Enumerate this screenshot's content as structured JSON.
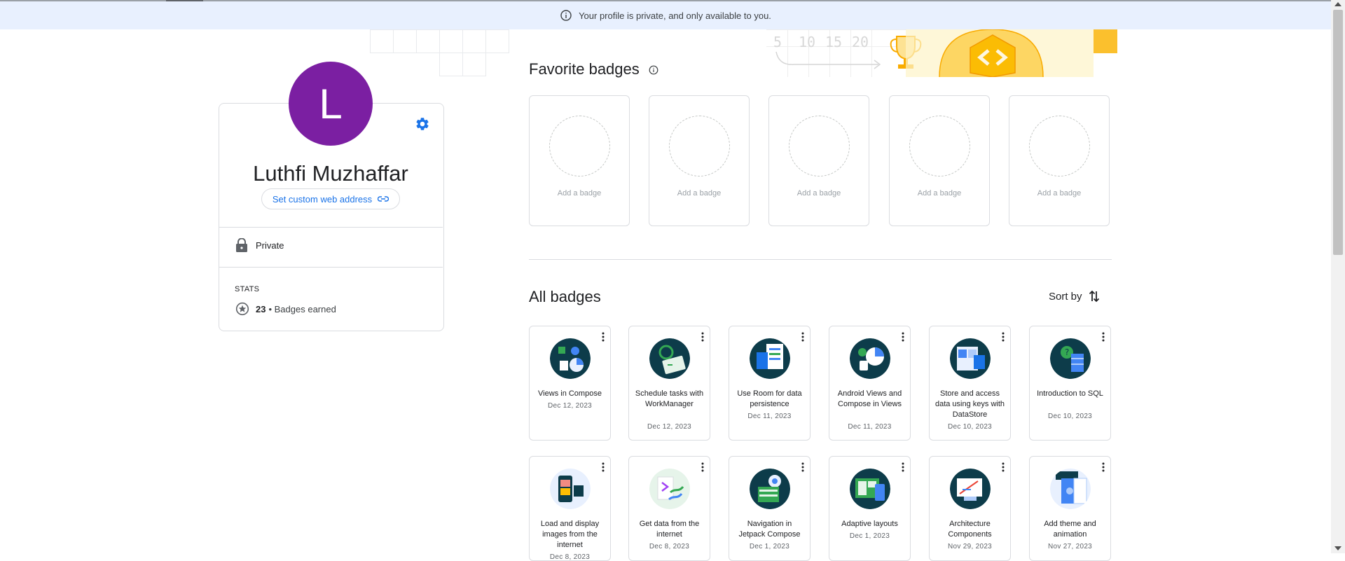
{
  "banner": {
    "text": "Your profile is private, and only available to you.",
    "icon": "info-icon"
  },
  "profile": {
    "avatar_letter": "L",
    "avatar_color": "#7b1fa2",
    "name": "Luthfi Muzhaffar",
    "custom_url_label": "Set custom web address",
    "privacy_label": "Private",
    "stats_label": "STATS",
    "badges_count": "23",
    "badges_suffix": "• Badges earned"
  },
  "decor": {
    "chart_numbers": [
      "5",
      "10",
      "15",
      "20"
    ]
  },
  "favorites": {
    "title": "Favorite badges",
    "slots": [
      {
        "label": "Add a badge"
      },
      {
        "label": "Add a badge"
      },
      {
        "label": "Add a badge"
      },
      {
        "label": "Add a badge"
      },
      {
        "label": "Add a badge"
      }
    ]
  },
  "all_badges": {
    "title": "All badges",
    "sort_label": "Sort by",
    "badges": [
      {
        "title": "Views in Compose",
        "date": "Dec 12, 2023",
        "icon": "views-compose-icon"
      },
      {
        "title": "Schedule tasks with WorkManager",
        "date": "Dec 12, 2023",
        "icon": "workmanager-icon"
      },
      {
        "title": "Use Room for data persistence",
        "date": "Dec 11, 2023",
        "icon": "room-icon"
      },
      {
        "title": "Android Views and Compose in Views",
        "date": "Dec 11, 2023",
        "icon": "android-views-icon"
      },
      {
        "title": "Store and access data using keys with DataStore",
        "date": "Dec 10, 2023",
        "icon": "datastore-icon"
      },
      {
        "title": "Introduction to SQL",
        "date": "Dec 10, 2023",
        "icon": "sql-icon"
      },
      {
        "title": "Load and display images from the internet",
        "date": "Dec 8, 2023",
        "icon": "load-images-icon"
      },
      {
        "title": "Get data from the internet",
        "date": "Dec 8, 2023",
        "icon": "get-data-icon"
      },
      {
        "title": "Navigation in Jetpack Compose",
        "date": "Dec 1, 2023",
        "icon": "navigation-icon"
      },
      {
        "title": "Adaptive layouts",
        "date": "Dec 1, 2023",
        "icon": "adaptive-layouts-icon"
      },
      {
        "title": "Architecture Components",
        "date": "Nov 29, 2023",
        "icon": "architecture-icon"
      },
      {
        "title": "Add theme and animation",
        "date": "Nov 27, 2023",
        "icon": "theme-animation-icon"
      }
    ]
  },
  "colors": {
    "accent": "#1a73e8",
    "banner_bg": "#e8f0fe",
    "badge_dark": "#0d3c4a",
    "badge_teal": "#1e8e8e"
  }
}
